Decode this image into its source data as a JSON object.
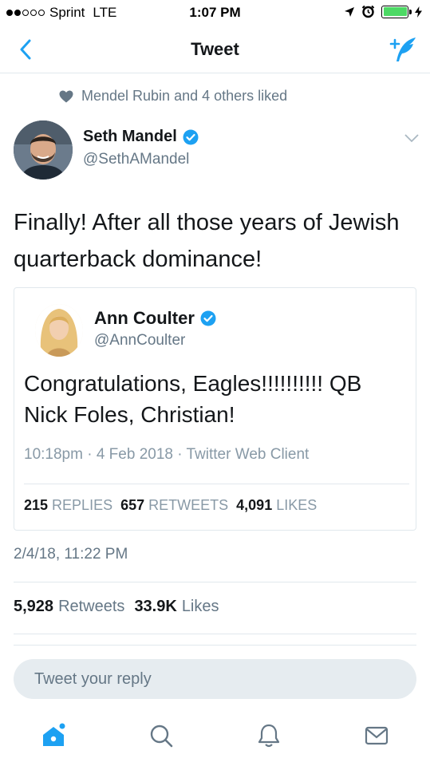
{
  "colors": {
    "accent": "#1da1f2",
    "text": "#14171a",
    "muted": "#657786",
    "border": "#e1e8ed"
  },
  "status_bar": {
    "carrier": "Sprint",
    "network": "LTE",
    "time": "1:07 PM",
    "battery_level": 1.0,
    "signal_bars": 2
  },
  "nav": {
    "title": "Tweet",
    "back_icon": "chevron-left-icon",
    "compose_icon": "compose-tweet-icon"
  },
  "social_context": {
    "icon": "heart-icon",
    "text": "Mendel Rubin and 4 others liked"
  },
  "tweet": {
    "author_name": "Seth Mandel",
    "author_handle": "@SethAMandel",
    "verified": true,
    "text": "Finally! After all those years of Jewish quarterback dominance!",
    "timestamp": "2/4/18, 11:22 PM",
    "retweets_count": "5,928",
    "retweets_label": "Retweets",
    "likes_count": "33.9K",
    "likes_label": "Likes"
  },
  "quoted_tweet": {
    "author_name": "Ann Coulter",
    "author_handle": "@AnnCoulter",
    "verified": true,
    "text": "Congratulations, Eagles!!!!!!!!!!  QB Nick Foles, Christian!",
    "meta": "10:18pm · 4 Feb 2018 · Twitter Web Client",
    "replies_count": "215",
    "replies_label": "REPLIES",
    "retweets_count": "657",
    "retweets_label": "RETWEETS",
    "likes_count": "4,091",
    "likes_label": "LIKES"
  },
  "reply": {
    "placeholder": "Tweet your reply"
  },
  "tab_bar": {
    "items": [
      "home-icon",
      "search-icon",
      "notifications-icon",
      "messages-icon"
    ],
    "active": "home-icon"
  }
}
